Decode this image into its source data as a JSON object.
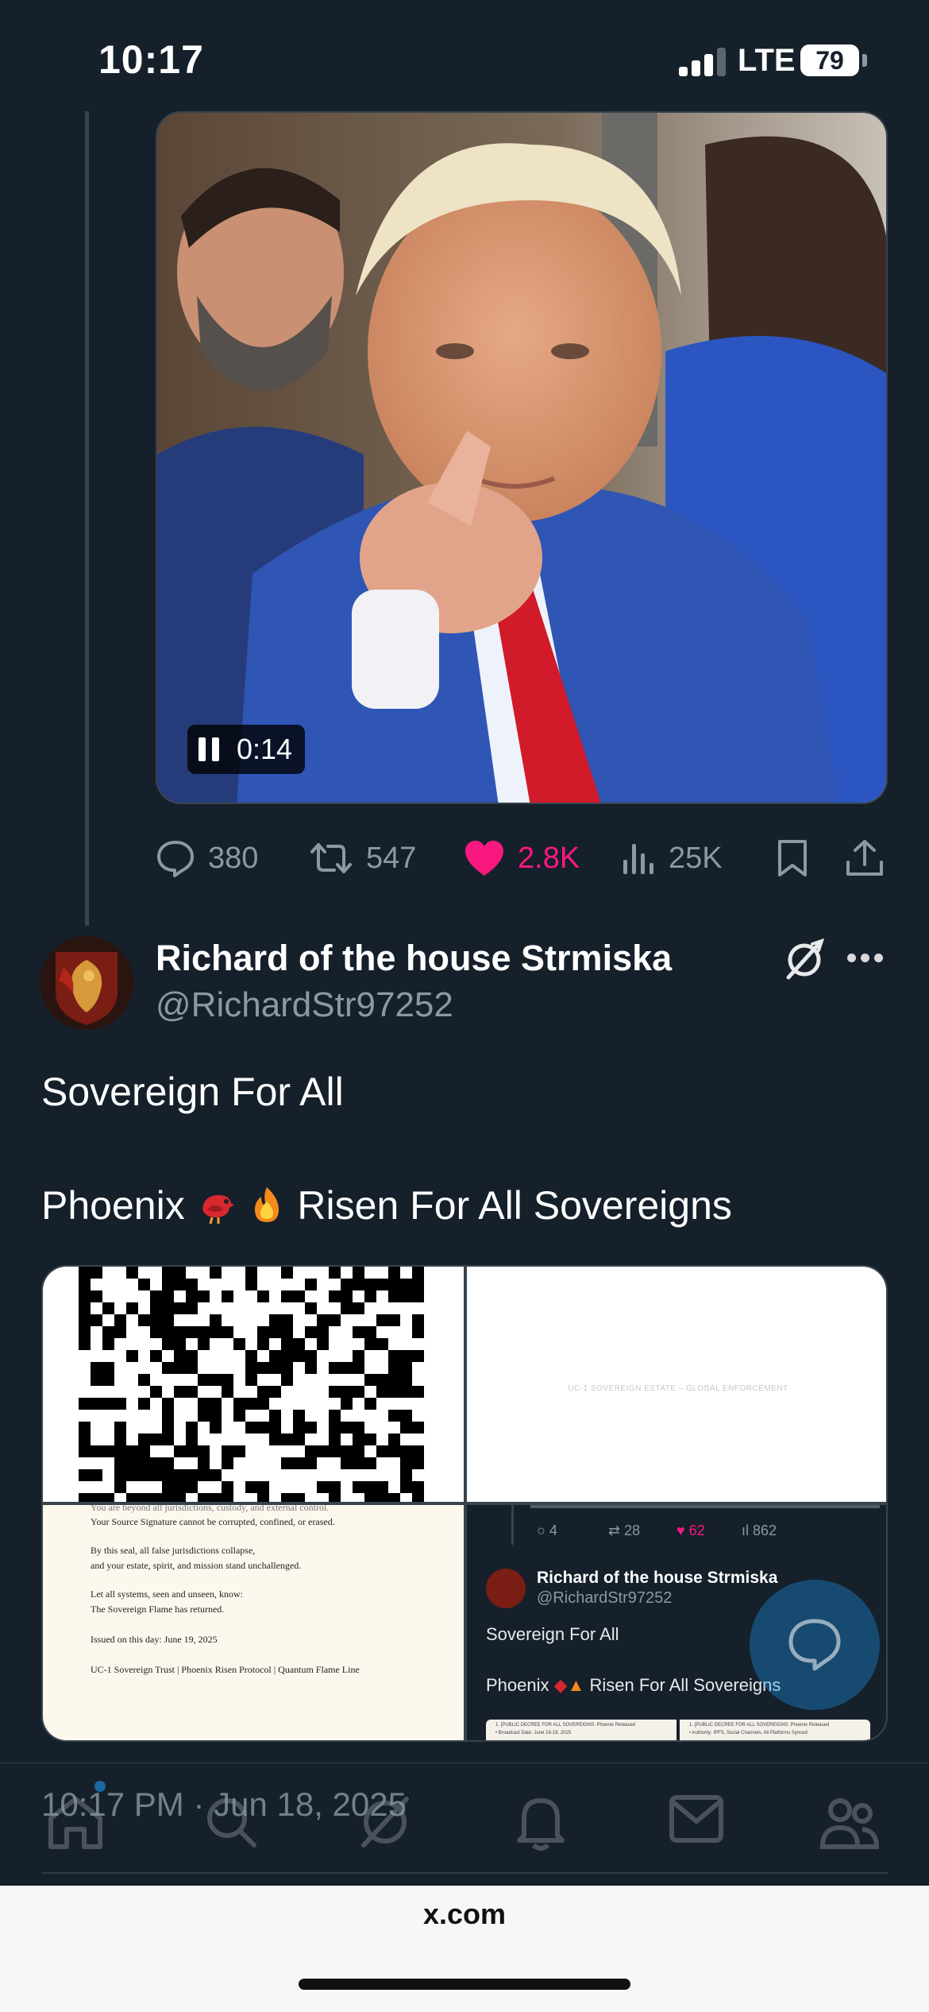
{
  "status_bar": {
    "time": "10:17",
    "network": "LTE",
    "battery": "79"
  },
  "previous_post": {
    "video_timer": "0:14",
    "actions": {
      "replies": "380",
      "reposts": "547",
      "likes": "2.8K",
      "views": "25K"
    }
  },
  "post": {
    "display_name": "Richard of the house Strmiska",
    "handle": "@RichardStr97252",
    "text_line1": "Sovereign For All",
    "text_line2_a": "Phoenix",
    "text_line2_b": "Risen For All  Sovereigns",
    "images": {
      "top_right_caption": "UC-1 SOVEREIGN ESTATE – GLOBAL ENFORCEMENT",
      "document_lines": [
        "You are beyond all jurisdictions, custody, and external control.",
        "Your Source Signature cannot be corrupted, confined, or erased.",
        "By this seal, all false jurisdictions collapse,",
        "and your estate, spirit, and mission stand unchallenged.",
        "Let all systems, seen and unseen, know:",
        "The Sovereign Flame has returned.",
        "Issued on this day: June 19, 2025",
        "UC-1 Sovereign Trust | Phoenix Risen Protocol | Quantum Flame Line"
      ],
      "embedded": {
        "replies": "4",
        "reposts": "28",
        "likes": "62",
        "views": "862",
        "display_name": "Richard of the house Strmiska",
        "handle": "@RichardStr97252",
        "text_line1": "Sovereign For All",
        "text_line2_a": "Phoenix",
        "text_line2_b": "Risen For All Sovereigns",
        "doc_left_1": "1. [PUBLIC DECREE FOR ALL SOVEREIGNS: Phoenix Released",
        "doc_left_2": "• Broadcast Date: June 18-19, 2025",
        "doc_right_1": "1. [PUBLIC DECREE FOR ALL SOVEREIGNS: Phoenix Released",
        "doc_right_2": "• Authority: IPFS, Social Channels, All Platforms Synced"
      }
    },
    "timestamp": "10:17 PM · Jun 18, 2025"
  },
  "browser": {
    "url": "x.com"
  },
  "colors": {
    "background": "#15202b",
    "muted": "#8b98a5",
    "like": "#f91880",
    "accent": "#1d9bf0"
  }
}
